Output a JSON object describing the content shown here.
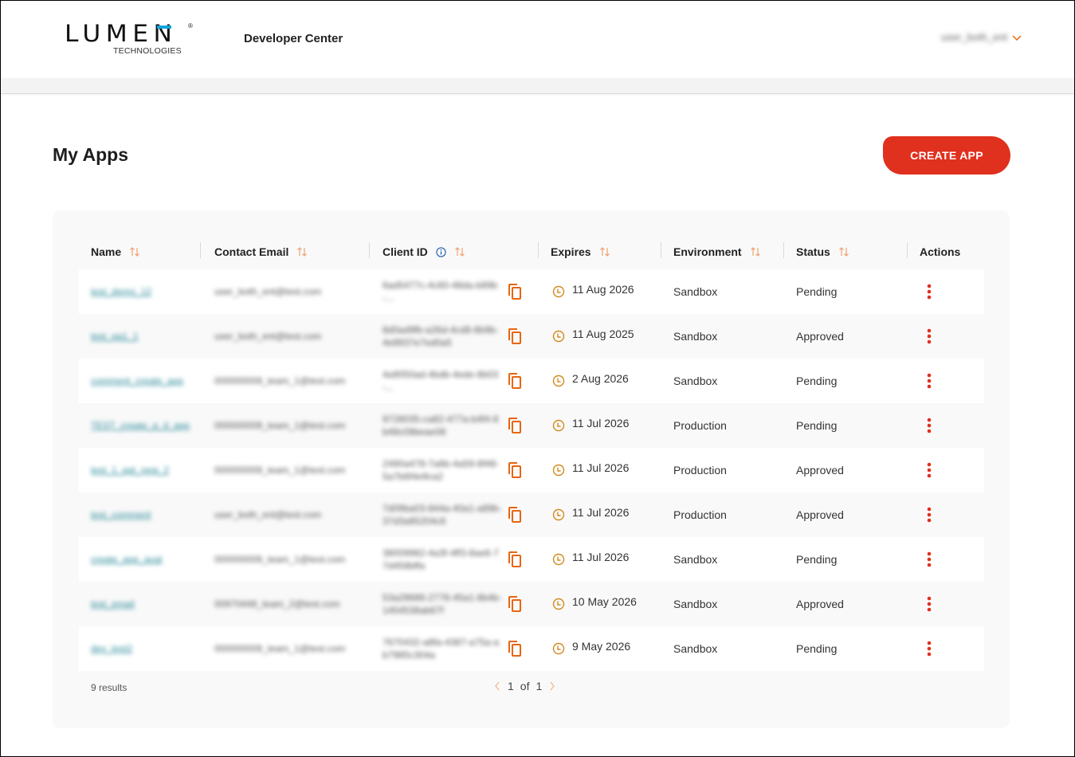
{
  "header": {
    "logo": {
      "wordmark": "LUMEN",
      "registered": "®",
      "subtitle": "TECHNOLOGIES",
      "accent_color": "#0ea5d9"
    },
    "site_title": "Developer Center",
    "user": {
      "name": "user_both_ent",
      "icon": "chevron-down-icon"
    }
  },
  "page": {
    "title": "My Apps",
    "create_button": "CREATE APP",
    "accent_color": "#e0301e"
  },
  "table": {
    "columns": [
      {
        "label": "Name",
        "sortable": true
      },
      {
        "label": "Contact Email",
        "sortable": true
      },
      {
        "label": "Client ID",
        "sortable": true,
        "info": true
      },
      {
        "label": "Expires",
        "sortable": true
      },
      {
        "label": "Environment",
        "sortable": true
      },
      {
        "label": "Status",
        "sortable": true
      },
      {
        "label": "Actions",
        "sortable": false
      }
    ],
    "rows": [
      {
        "name": "test_demo_12",
        "email": "user_both_ent@test.com",
        "client_id": "6ad5477c-4c60-48da-b89b-...",
        "expires": "11 Aug 2026",
        "environment": "Sandbox",
        "status": "Pending"
      },
      {
        "name": "test_qa1_1",
        "email": "user_both_ent@test.com",
        "client_id": "8d0ad9fb-a26d-4cd8-8b9b-4e8937e7ed0a5",
        "expires": "11 Aug 2025",
        "environment": "Sandbox",
        "status": "Approved"
      },
      {
        "name": "comment_create_app",
        "email": "000000009_team_1@test.com",
        "client_id": "4a9050ad-4bdb-4ede-8b03-...",
        "expires": "2 Aug 2026",
        "environment": "Sandbox",
        "status": "Pending"
      },
      {
        "name": "TEST_create_a_d_app",
        "email": "000000009_team_1@test.com",
        "client_id": "9728035-ca82-477a-b4f4-8b48c09beae08",
        "expires": "11 Jul 2026",
        "environment": "Production",
        "status": "Pending"
      },
      {
        "name": "test_1_qat_new_2",
        "email": "000000009_team_1@test.com",
        "client_id": "2490a478-7a6b-4a59-8f48-5a7b6f4e9ca2",
        "expires": "11 Jul 2026",
        "environment": "Production",
        "status": "Approved"
      },
      {
        "name": "test_comment",
        "email": "user_both_ent@test.com",
        "client_id": "7d09ba03-844a-40a1-a89b-37d3a85204c6",
        "expires": "11 Jul 2026",
        "environment": "Production",
        "status": "Approved"
      },
      {
        "name": "create_app_qual",
        "email": "000000009_team_1@test.com",
        "client_id": "38009982-4a3f-4ff3-8ae6-77d458bffa",
        "expires": "11 Jul 2026",
        "environment": "Sandbox",
        "status": "Pending"
      },
      {
        "name": "test_email",
        "email": "00970448_team_2@test.com",
        "client_id": "53a28686-2778-45a1-8b4b-1454538ab67f",
        "expires": "10 May 2026",
        "environment": "Sandbox",
        "status": "Approved"
      },
      {
        "name": "dev_test2",
        "email": "000000009_team_1@test.com",
        "client_id": "7670432-a8fa-4387-a75a-ab7985c304a",
        "expires": "9 May 2026",
        "environment": "Sandbox",
        "status": "Pending"
      }
    ]
  },
  "footer": {
    "results": "9 results",
    "page_current": "1",
    "page_of": "of",
    "page_total": "1"
  },
  "icons": {
    "sort": "sort-arrows-icon",
    "info": "info-icon",
    "copy": "copy-icon",
    "clock": "clock-icon",
    "actions": "kebab-menu-icon",
    "prev": "chevron-left-icon",
    "next": "chevron-right-icon"
  },
  "colors": {
    "sort_icon": "#f0a070",
    "copy_icon": "#e8650f",
    "clock_icon": "#d28a1e",
    "kebab": "#e0301e",
    "info_icon": "#1f5fa8",
    "link": "#2a8a99"
  }
}
